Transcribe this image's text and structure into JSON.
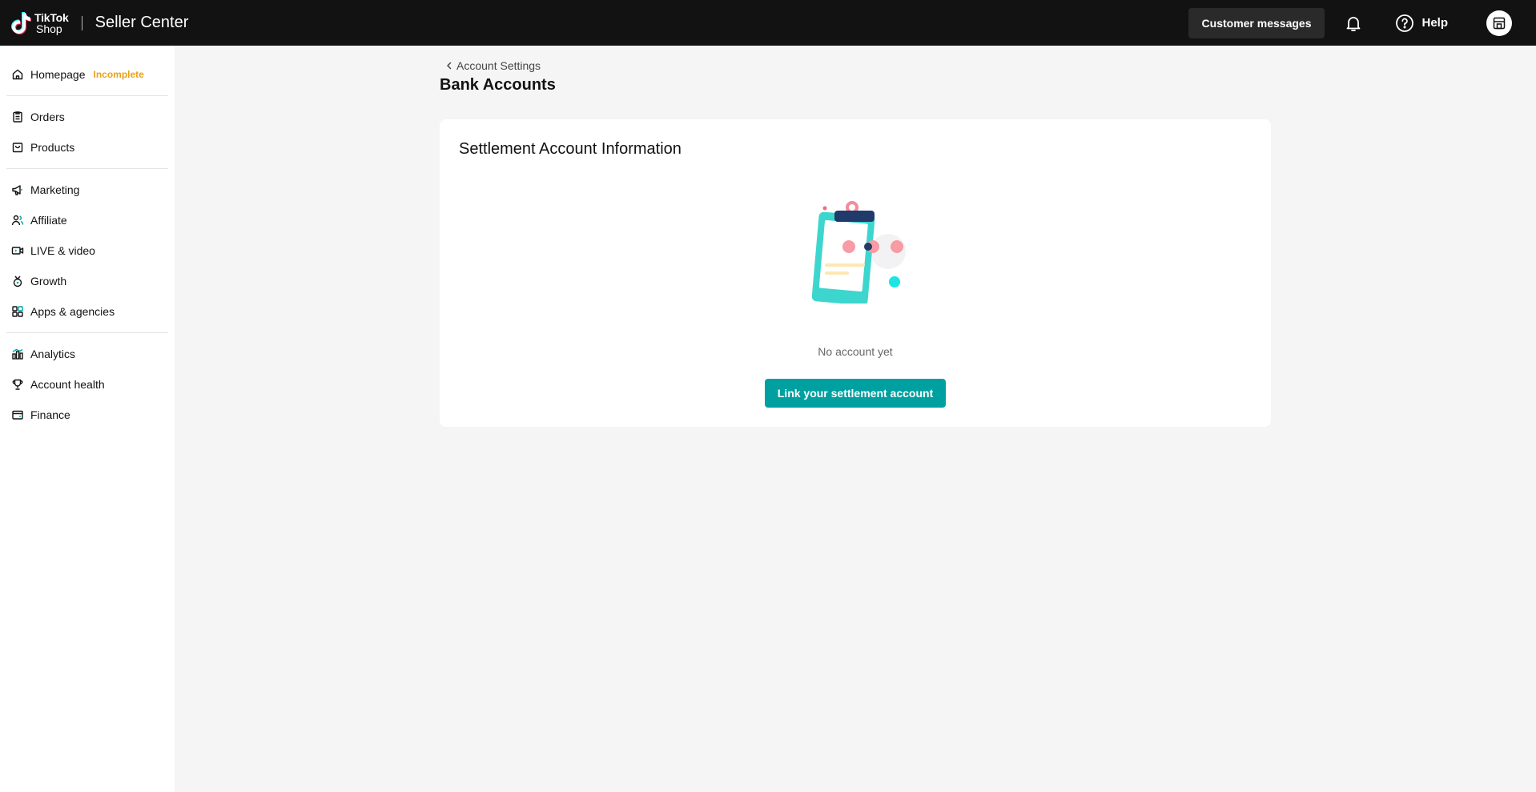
{
  "header": {
    "logo_line1": "TikTok",
    "logo_line2": "Shop",
    "title": "Seller Center",
    "customer_messages": "Customer messages",
    "help": "Help",
    "icons": [
      "tiktok-logo-icon",
      "bell-icon",
      "help-circle-icon",
      "store-icon"
    ]
  },
  "sidebar": {
    "items": [
      {
        "label": "Homepage",
        "badge": "Incomplete",
        "icon": "home-icon"
      },
      {
        "label": "Orders",
        "icon": "clipboard-icon"
      },
      {
        "label": "Products",
        "icon": "bag-icon"
      },
      {
        "label": "Marketing",
        "icon": "megaphone-icon"
      },
      {
        "label": "Affiliate",
        "icon": "people-icon"
      },
      {
        "label": "LIVE & video",
        "icon": "video-icon"
      },
      {
        "label": "Growth",
        "icon": "medal-icon"
      },
      {
        "label": "Apps & agencies",
        "icon": "apps-icon"
      },
      {
        "label": "Analytics",
        "icon": "chart-icon"
      },
      {
        "label": "Account health",
        "icon": "trophy-icon"
      },
      {
        "label": "Finance",
        "icon": "wallet-icon"
      }
    ]
  },
  "main": {
    "breadcrumb": "Account Settings",
    "title": "Bank Accounts",
    "card": {
      "title": "Settlement Account Information",
      "empty_text": "No account yet",
      "button": "Link your settlement account"
    }
  },
  "colors": {
    "topbar": "#121212",
    "accent": "#00a0a0",
    "badge": "#e8a21c"
  }
}
